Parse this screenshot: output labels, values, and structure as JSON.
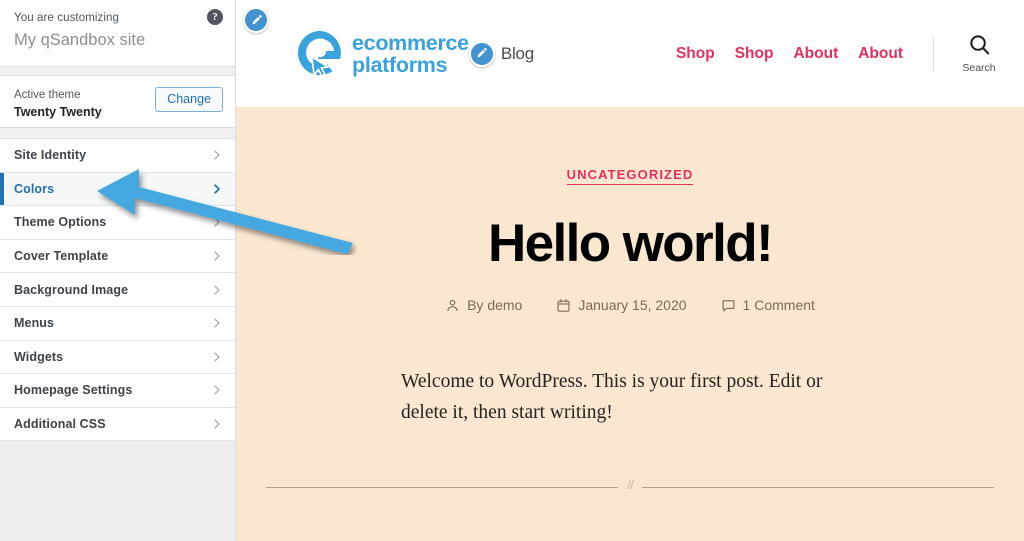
{
  "customizer": {
    "customizing_label": "You are customizing",
    "site_name": "My qSandbox site",
    "help_icon": "help-icon",
    "active_theme_label": "Active theme",
    "active_theme_name": "Twenty Twenty",
    "change_label": "Change",
    "accent_color": "#2271b1",
    "menu_items": [
      {
        "label": "Site Identity",
        "active": false
      },
      {
        "label": "Colors",
        "active": true
      },
      {
        "label": "Theme Options",
        "active": false
      },
      {
        "label": "Cover Template",
        "active": false
      },
      {
        "label": "Background Image",
        "active": false
      },
      {
        "label": "Menus",
        "active": false
      },
      {
        "label": "Widgets",
        "active": false
      },
      {
        "label": "Homepage Settings",
        "active": false
      },
      {
        "label": "Additional CSS",
        "active": false
      }
    ]
  },
  "annotation": {
    "arrow_icon": "arrow-pointing-left-icon",
    "arrow_color": "#45a8e0"
  },
  "preview": {
    "background_color": "#fae7d0",
    "corner_edit_icon": "pencil-edit-icon",
    "header": {
      "logo_icon": "ecommerce-platforms-logo-icon",
      "logo_line1": "ecommerce",
      "logo_line2": "platforms",
      "logo_color": "#3aa2dd",
      "site_title_edit_icon": "pencil-edit-icon",
      "site_title": "Blog",
      "nav_links": [
        "Shop",
        "Shop",
        "About",
        "About"
      ],
      "nav_link_color": "#e5305d",
      "search_icon": "search-icon",
      "search_label": "Search"
    },
    "post": {
      "category": "UNCATEGORIZED",
      "title": "Hello world!",
      "author_icon": "person-icon",
      "author": "By demo",
      "date_icon": "calendar-icon",
      "date": "January 15, 2020",
      "comments_icon": "comment-bubble-icon",
      "comments": "1 Comment",
      "body": "Welcome to WordPress. This is your first post. Edit or delete it, then start writing!",
      "separator_glyph": "//"
    }
  }
}
